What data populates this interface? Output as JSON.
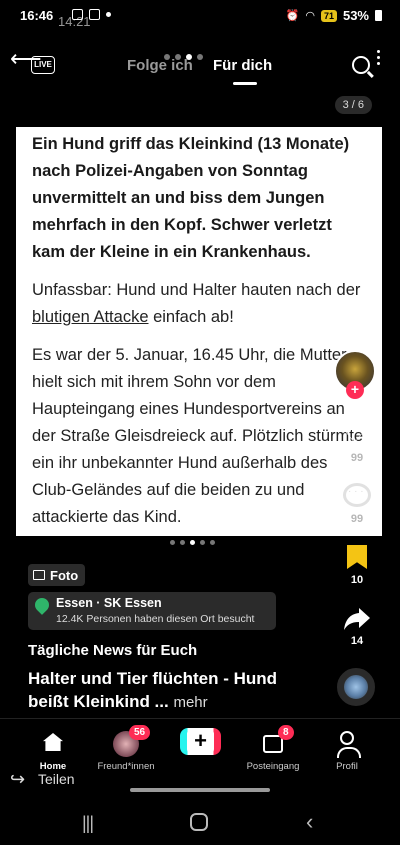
{
  "status_bar": {
    "time": "16:46",
    "time_ghost": "14:21",
    "badge": "71",
    "battery": "53%"
  },
  "top_nav": {
    "live_label": "LIVE",
    "tab_following": "Folge ich",
    "tab_foryou": "Für dich"
  },
  "counter": "3 / 6",
  "article": {
    "lead": "Ein Hund griff das Kleinkind (13 Monate) nach Polizei-Angaben von Sonntag unvermittelt an und biss dem Jungen mehrfach in den Kopf. Schwer verletzt kam der Kleine in ein Krankenhaus.",
    "p2_start": "Unfassbar: Hund und Halter hauten nach der ",
    "p2_link": "blutigen Attacke",
    "p2_end": " einfach ab!",
    "p3": "Es war der 5. Januar, 16.45 Uhr, die Mutter hielt sich mit ihrem Sohn vor dem Haupteingang eines Hundesportvereins an der Straße Gleisdreieck auf. Plötzlich stürmte ein ihr unbekannter Hund außerhalb des Club-Geländes auf die beiden zu und attackierte das Kind."
  },
  "sidebar": {
    "likes": "99",
    "comments": "99",
    "bookmarks": "10",
    "shares": "14"
  },
  "post": {
    "tag": "Foto",
    "location_name": "Essen · SK Essen",
    "location_sub": "12.4K Personen haben diesen Ort besucht",
    "author": "Tägliche News für Euch",
    "caption": "Halter und Tier flüchten - Hund beißt Kleinkind ...",
    "more": "mehr"
  },
  "bottom_nav": {
    "home": "Home",
    "friends": "Freund*innen",
    "friends_badge": "56",
    "inbox": "Posteingang",
    "inbox_badge": "8",
    "profile": "Profil"
  },
  "share_strip": {
    "label": "Teilen"
  },
  "colors": {
    "accent": "#fe2c55",
    "bookmark": "#f4c414",
    "location_pin": "#2fb56a"
  }
}
